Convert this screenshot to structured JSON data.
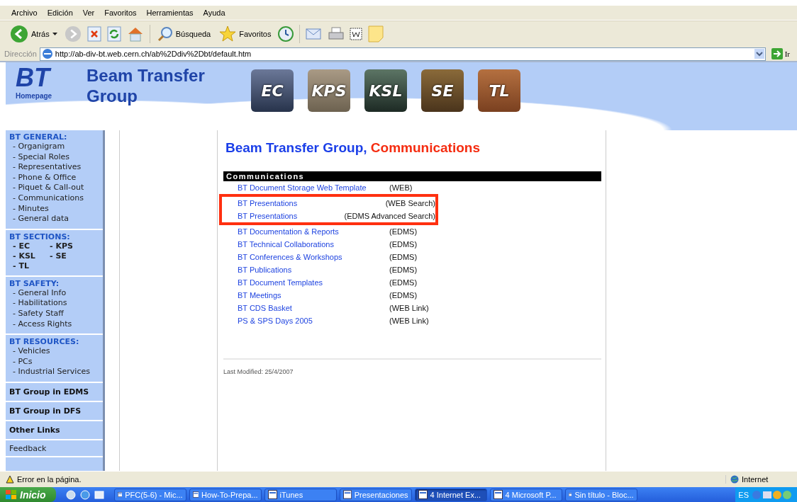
{
  "menu_bar": [
    "Archivo",
    "Edición",
    "Ver",
    "Favoritos",
    "Herramientas",
    "Ayuda"
  ],
  "toolbar": {
    "back": "Atrás",
    "search": "Búsqueda",
    "favorites": "Favoritos"
  },
  "address_bar": {
    "label": "Dirección",
    "url": "http://ab-div-bt.web.cern.ch/ab%2Ddiv%2Dbt/default.htm",
    "go": "Ir"
  },
  "banner": {
    "logo": "BT",
    "logo_caption": "Homepage",
    "title_line1": "Beam Transfer",
    "title_line2": "Group",
    "section_tiles": [
      "EC",
      "KPS",
      "KSL",
      "SE",
      "TL"
    ]
  },
  "sidebar": [
    {
      "kind": "group",
      "heading": "BT GENERAL:",
      "items": [
        "- Organigram",
        "- Special Roles",
        "- Representatives",
        "- Phone & Office",
        "- Piquet & Call-out",
        "- Communications",
        "- Minutes",
        "- General data"
      ]
    },
    {
      "kind": "grid",
      "heading": "BT SECTIONS:",
      "items": [
        "- EC",
        "- KPS",
        "- KSL",
        "- SE",
        "- TL"
      ]
    },
    {
      "kind": "group",
      "heading": "BT SAFETY:",
      "items": [
        "- General Info",
        "- Habilitations",
        "- Safety Staff",
        "- Access Rights"
      ]
    },
    {
      "kind": "group",
      "heading": "BT RESOURCES:",
      "items": [
        "- Vehicles",
        "- PCs",
        "- Industrial Services"
      ]
    },
    {
      "kind": "bold",
      "heading": "BT Group in EDMS"
    },
    {
      "kind": "bold",
      "heading": "BT Group in DFS"
    },
    {
      "kind": "bold",
      "heading": "Other Links"
    },
    {
      "kind": "plain",
      "heading": "Feedback"
    }
  ],
  "content": {
    "title": "Beam Transfer Group,",
    "title_section": "Communications",
    "table_header": "Communications",
    "rows": [
      {
        "link": "BT Document Storage Web Template",
        "type": "(WEB)",
        "highlighted": false
      },
      {
        "link": "BT Presentations",
        "type": "(WEB Search)",
        "highlighted": true
      },
      {
        "link": "BT Presentations",
        "type": "(EDMS Advanced Search)",
        "highlighted": true
      },
      {
        "link": "BT Documentation & Reports",
        "type": "(EDMS)",
        "highlighted": false
      },
      {
        "link": "BT Technical Collaborations",
        "type": "(EDMS)",
        "highlighted": false
      },
      {
        "link": "BT Conferences & Workshops",
        "type": "(EDMS)",
        "highlighted": false
      },
      {
        "link": "BT Publications",
        "type": "(EDMS)",
        "highlighted": false
      },
      {
        "link": "BT Document Templates",
        "type": "(EDMS)",
        "highlighted": false
      },
      {
        "link": "BT Meetings",
        "type": "(EDMS)",
        "highlighted": false
      },
      {
        "link": "BT CDS Basket",
        "type": "(WEB Link)",
        "highlighted": false
      },
      {
        "link": "PS & SPS Days 2005",
        "type": "(WEB Link)",
        "highlighted": false
      }
    ],
    "last_modified": "Last Modified: 25/4/2007"
  },
  "status_bar": {
    "message": "Error en la página.",
    "zone": "Internet"
  },
  "taskbar": {
    "start": "Inicio",
    "buttons": [
      {
        "label": "PFC(5-6) - Mic...",
        "selected": false
      },
      {
        "label": "How-To-Prepa...",
        "selected": false
      },
      {
        "label": "iTunes",
        "selected": false
      },
      {
        "label": "Presentaciones",
        "selected": false
      },
      {
        "label": "4 Internet Ex...",
        "selected": true
      },
      {
        "label": "4 Microsoft P...",
        "selected": false
      },
      {
        "label": "Sin título - Bloc...",
        "selected": false
      }
    ],
    "language": "ES"
  }
}
